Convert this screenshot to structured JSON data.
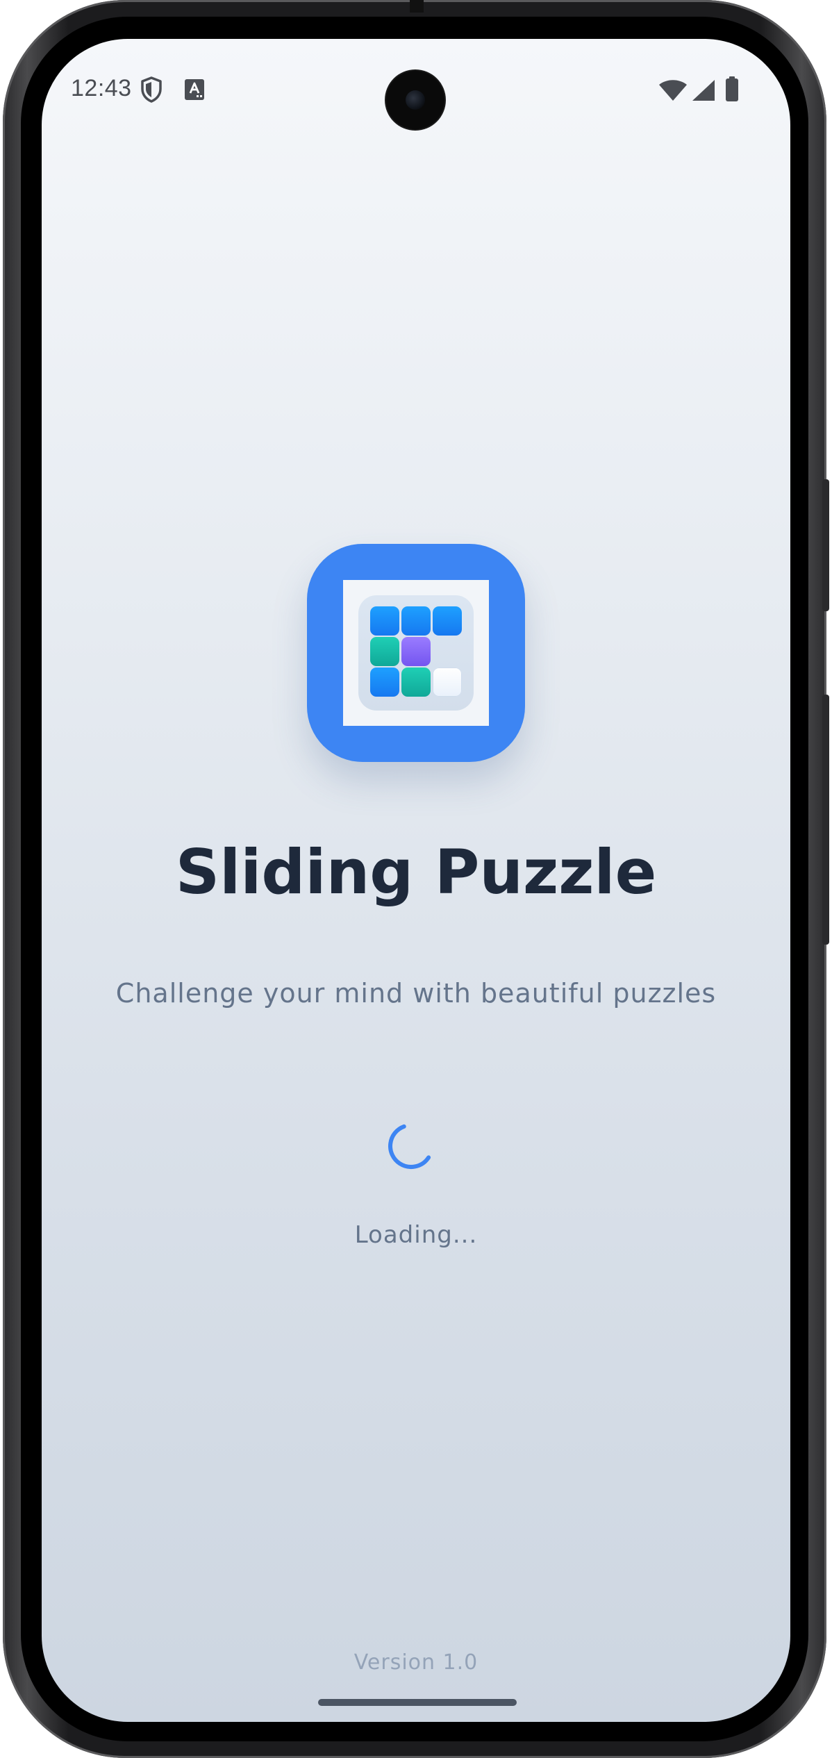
{
  "status_bar": {
    "time": "12:43",
    "left_icons": [
      "shield-icon",
      "font-download-icon"
    ],
    "right_icons": [
      "wifi-icon",
      "cellular-signal-icon",
      "battery-icon"
    ]
  },
  "app": {
    "icon": "sliding-puzzle-app-icon",
    "title": "Sliding Puzzle",
    "subtitle": "Challenge your mind with beautiful puzzles",
    "loading_text": "Loading...",
    "version": "Version 1.0"
  },
  "colors": {
    "accent": "#3d85f3",
    "title": "#1e293b",
    "subtitle": "#64748b",
    "version": "#94a3b8",
    "tile_blue": "#1e8cf8",
    "tile_teal": "#16bca7",
    "tile_purple": "#8a6cfb"
  },
  "puzzle_grid": [
    [
      "blue",
      "blue",
      "blue"
    ],
    [
      "teal",
      "purple",
      "empty"
    ],
    [
      "blue",
      "teal",
      "white"
    ]
  ]
}
